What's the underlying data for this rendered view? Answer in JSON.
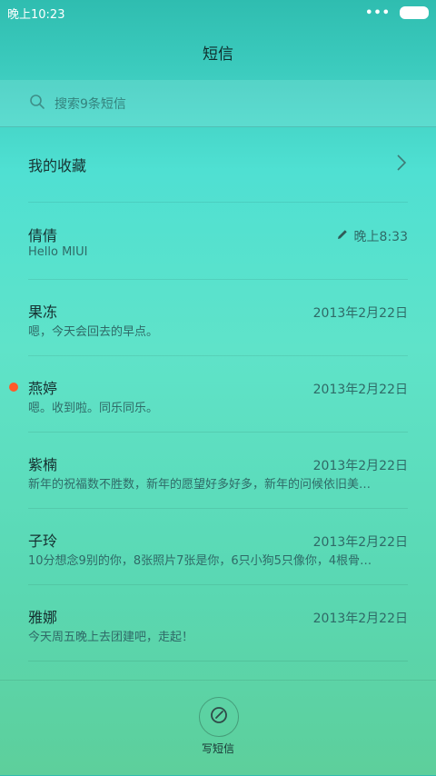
{
  "status_bar": {
    "time": "晚上10:23",
    "signal_dots": "•••"
  },
  "header": {
    "title": "短信"
  },
  "search": {
    "placeholder": "搜索9条短信"
  },
  "favorites": {
    "label": "我的收藏"
  },
  "conversations": [
    {
      "name": "倩倩",
      "preview": "Hello MIUI",
      "date": "晚上8:33",
      "draft": true,
      "unread": false
    },
    {
      "name": "果冻",
      "preview": "嗯，今天会回去的早点。",
      "date": "2013年2月22日",
      "draft": false,
      "unread": false
    },
    {
      "name": "燕婷",
      "preview": "嗯。收到啦。同乐同乐。",
      "date": "2013年2月22日",
      "draft": false,
      "unread": true
    },
    {
      "name": "紫楠",
      "preview": "新年的祝福数不胜数，新年的愿望好多好多，新年的问候依旧美…",
      "date": "2013年2月22日",
      "draft": false,
      "unread": false
    },
    {
      "name": "子玲",
      "preview": "10分想念9别的你，8张照片7张是你，6只小狗5只像你，4根骨…",
      "date": "2013年2月22日",
      "draft": false,
      "unread": false
    },
    {
      "name": "雅娜",
      "preview": "今天周五晚上去团建吧，走起！",
      "date": "2013年2月22日",
      "draft": false,
      "unread": false
    }
  ],
  "compose": {
    "label": "写短信"
  },
  "colors": {
    "unread_dot": "#ff5a2a"
  }
}
